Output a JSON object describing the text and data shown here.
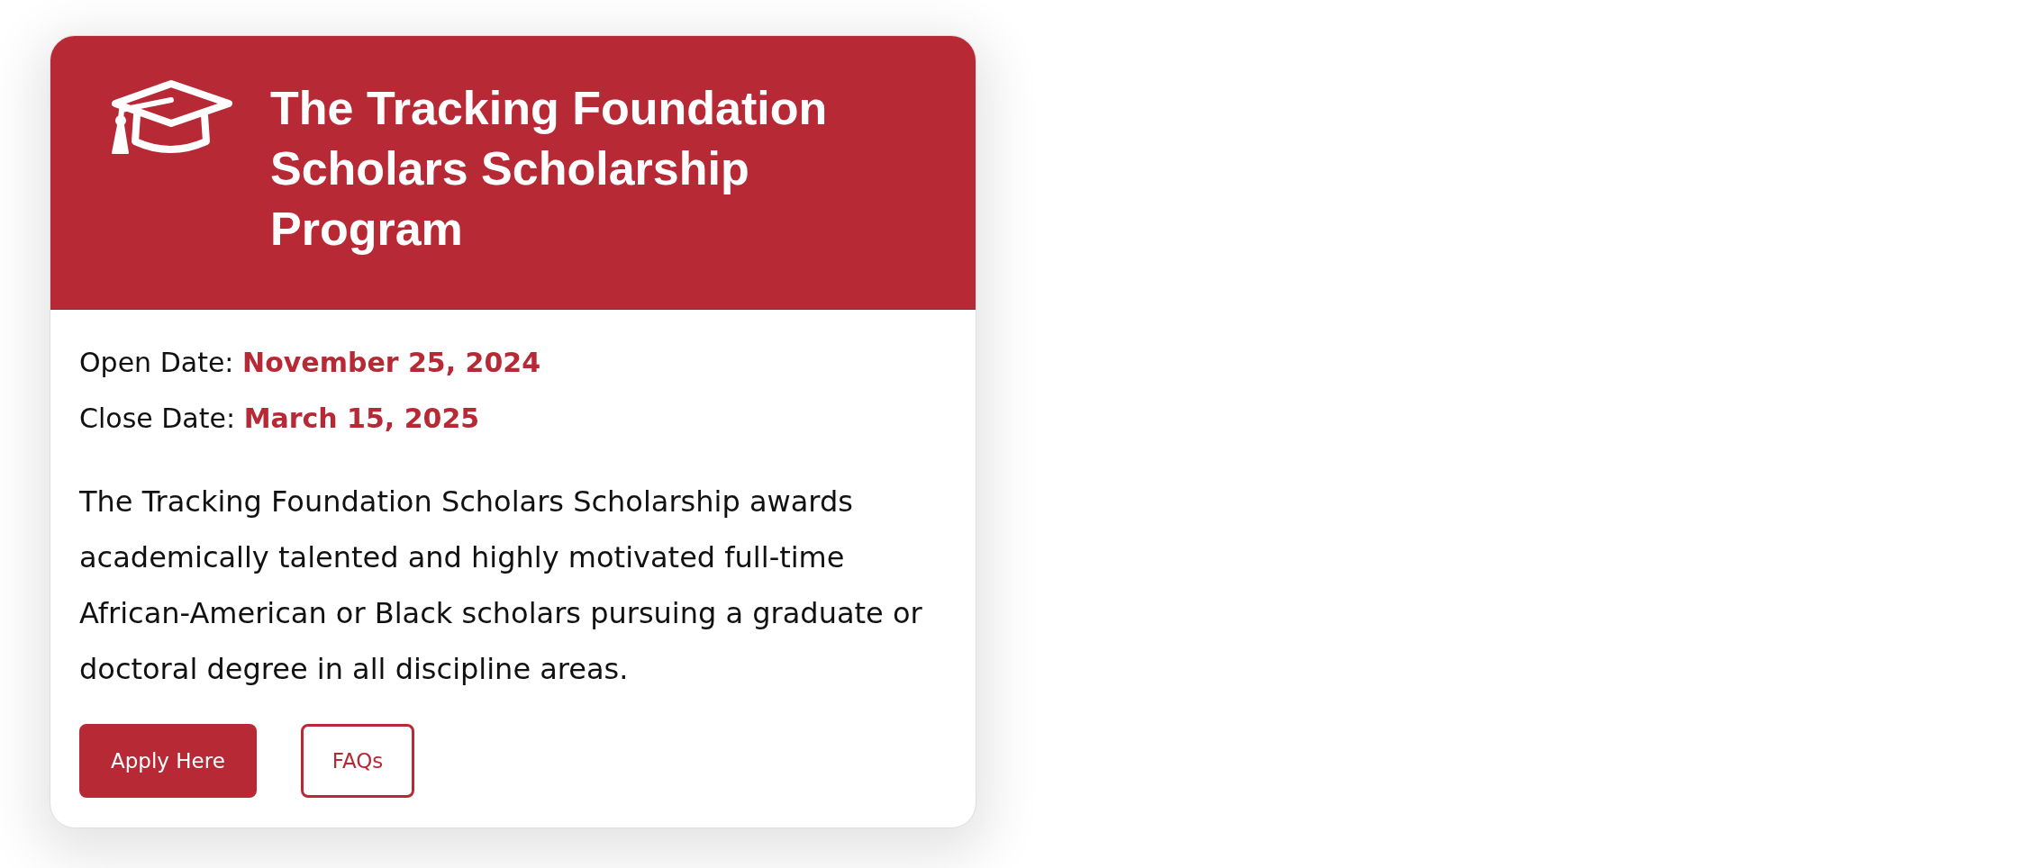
{
  "card": {
    "title": "The Tracking Foundation Scholars Scholarship Program",
    "dates": [
      {
        "label": "Open Date:",
        "value": "November 25, 2024"
      },
      {
        "label": "Close Date:",
        "value": "March 15, 2025"
      }
    ],
    "description": "The Tracking Foundation Scholars Scholarship awards academically talented and highly motivated full-time African-American or Black scholars pursuing a graduate or doctoral degree in all discipline areas.",
    "buttons": [
      {
        "label": "Apply Here",
        "kind": "primary"
      },
      {
        "label": "FAQs",
        "kind": "outline"
      }
    ]
  }
}
